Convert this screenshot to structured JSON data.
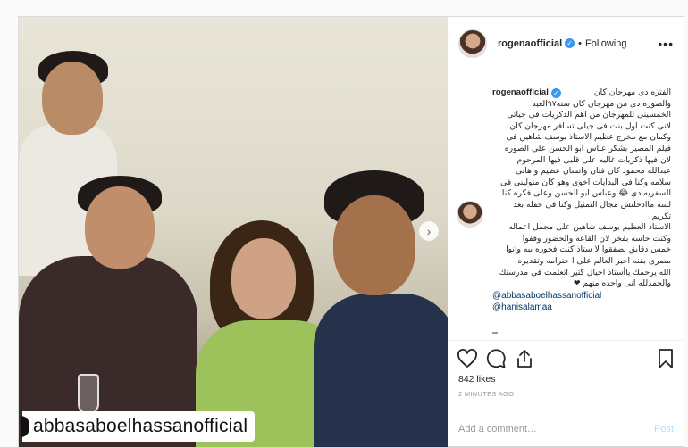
{
  "post": {
    "photo_watermark": "abbasaboelhassanofficial",
    "username": "rogenaofficial",
    "follow_status": "Following",
    "separator": "•",
    "more_label": "•••",
    "caption": {
      "lines": [
        "الفتره دى مهرجان كان",
        "والصوره دى من مهرجان كان سنه٩٧العيد",
        "الخمسينى للمهرجان من اهم الذكريات فى حياتى",
        "لانى كنت اول بنت فى جيلى تسافر مهرجان كان",
        "وكمان مع مخرج عظيم الاستاذ يوسف شاهين فى",
        "فيلم المصير بشكر عباس ابو الحسن على الصوره",
        "لان فيها ذكريات غاليه على قلبى فيها المرحوم",
        "عبدالله محمود كان فنان وانسان عظيم و هانى",
        "سلامه وكنا فى البدايات اخوى وهو كان متوليني فى",
        "السفريه دى 😂 وعباس ابو الحسن وعلى فكره كنا",
        "لسه ماادخلنش مجال التمثيل وكنا فى حفله بعد تكريم",
        "الاستاذ العظيم يوسف شاهين على مجمل اعماله",
        "وكنت حاسه بفخر لان القاعه والحضور وقفوا",
        "خمس دقايق يصفقوا لا ستاذ كنت فخوره بيه وانوا",
        "مصرى بقنه اجبر العالم على ا حترامه وتقديره",
        "الله يرحمك ياأستاذ اجيال كتير اتعلمت فى مدرستك",
        "والحمدلله انى واحده منهم ❤"
      ],
      "mentions": [
        "@abbasaboelhassanofficial",
        "@hanisalamaa"
      ]
    },
    "likes": "842 likes",
    "time": "2 MINUTES AGO",
    "comment_placeholder": "Add a comment…",
    "post_button": "Post"
  },
  "icons": {
    "like": "heart-icon",
    "comment": "comment-icon",
    "share": "share-icon",
    "save": "bookmark-icon",
    "next": "chevron-right-icon",
    "verified": "verified-badge-icon"
  },
  "colors": {
    "verified": "#3897f0",
    "mention": "#003569",
    "post_disabled": "#b2dffc"
  }
}
